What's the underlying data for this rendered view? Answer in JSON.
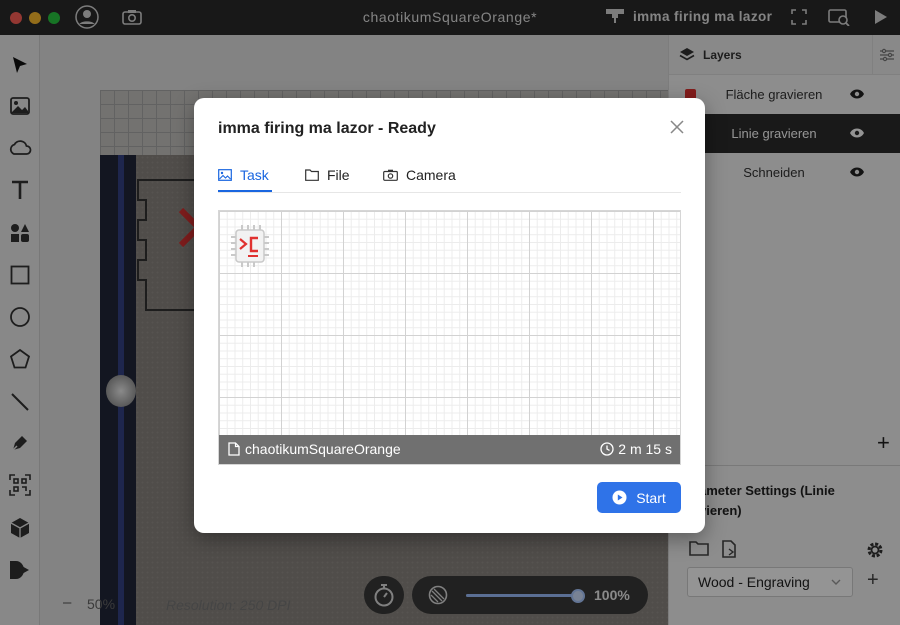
{
  "window": {
    "title": "chaotikumSquareOrange*",
    "machine_name": "imma firing ma lazor"
  },
  "layers": {
    "header": "Layers",
    "items": [
      {
        "name": "Fläche gravieren",
        "color": "#e0312f",
        "active": false
      },
      {
        "name": "Linie gravieren",
        "active": true
      },
      {
        "name": "Schneiden",
        "active": false
      }
    ]
  },
  "parameters": {
    "title": "Parameter Settings (Linie gravieren)",
    "title_visible": "ameter Settings (Linie\nvieren)",
    "preset": "Wood - Engraving"
  },
  "canvas": {
    "zoom": "50%",
    "resolution": "Resolution: 250 DPI",
    "power_value": "100%",
    "power_fraction": 1.0
  },
  "modal": {
    "title": "imma firing ma lazor - Ready",
    "tabs": [
      {
        "label": "Task",
        "icon": "image-icon",
        "active": true
      },
      {
        "label": "File",
        "icon": "folder-icon",
        "active": false
      },
      {
        "label": "Camera",
        "icon": "camera-icon",
        "active": false
      }
    ],
    "file_name": "chaotikumSquareOrange",
    "time_estimate": "2 m 15 s",
    "start_label": "Start"
  },
  "colors": {
    "accent": "#2f73e8",
    "layer_red": "#e0312f"
  }
}
